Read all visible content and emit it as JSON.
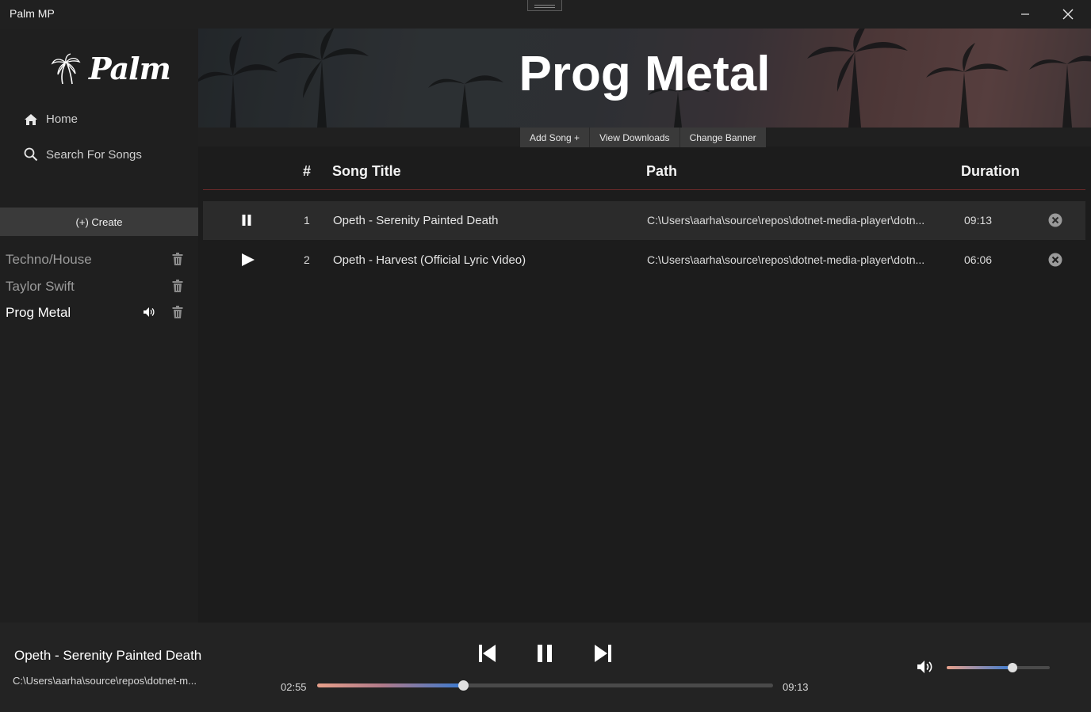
{
  "window": {
    "title": "Palm MP"
  },
  "sidebar": {
    "logo_text": "Palm",
    "nav": [
      {
        "label": "Home",
        "icon": "home-icon"
      },
      {
        "label": "Search For Songs",
        "icon": "search-icon"
      }
    ],
    "create_label": "(+) Create",
    "playlists": [
      {
        "name": "Techno/House",
        "active": false
      },
      {
        "name": "Taylor Swift",
        "active": false
      },
      {
        "name": "Prog Metal",
        "active": true
      }
    ]
  },
  "main": {
    "banner_title": "Prog Metal",
    "toolbar": {
      "add_song": "Add Song +",
      "view_downloads": "View Downloads",
      "change_banner": "Change Banner"
    },
    "columns": {
      "num": "#",
      "title": "Song Title",
      "path": "Path",
      "duration": "Duration"
    },
    "songs": [
      {
        "num": "1",
        "title": "Opeth - Serenity Painted Death",
        "path": "C:\\Users\\aarha\\source\\repos\\dotnet-media-player\\dotn...",
        "duration": "09:13",
        "state": "playing"
      },
      {
        "num": "2",
        "title": "Opeth - Harvest (Official Lyric Video)",
        "path": "C:\\Users\\aarha\\source\\repos\\dotnet-media-player\\dotn...",
        "duration": "06:06",
        "state": "stopped"
      }
    ]
  },
  "player": {
    "now_title": "Opeth - Serenity Painted Death",
    "now_path": "C:\\Users\\aarha\\source\\repos\\dotnet-m...",
    "current_time": "02:55",
    "total_time": "09:13",
    "progress": 0.32,
    "volume": 0.64
  },
  "colors": {
    "accent_start": "#e8a08a",
    "accent_end": "#3a7ad0",
    "header_divider": "#6a2a2a"
  }
}
